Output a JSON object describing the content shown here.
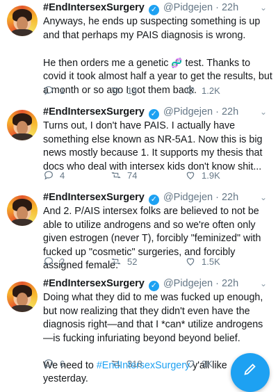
{
  "tweets": [
    {
      "name": "#EndIntersexSurgery",
      "handle": "@Pidgejen",
      "time": "22h",
      "p1": "Anyways, he ends up suspecting something is up and that perhaps my PAIS diagnosis is wrong.",
      "p2a": "He then orders me a genetic ",
      "dna": "🧬",
      "p2b": " test. Thanks to covid it took almost half a year to get the results, but a month or so ago I got them back.",
      "replies": "1",
      "retweets": "14",
      "likes": "1.2K"
    },
    {
      "name": "#EndIntersexSurgery",
      "handle": "@Pidgejen",
      "time": "22h",
      "p1": "Turns out, I don't have PAIS. I actually have something else known as NR-5A1. Now this is big news mostly because 1. It supports my thesis that docs who deal with intersex kids don't know shit...",
      "replies": "4",
      "retweets": "74",
      "likes": "1.9K"
    },
    {
      "name": "#EndIntersexSurgery",
      "handle": "@Pidgejen",
      "time": "22h",
      "p1": "And 2. P/AIS intersex folks are believed to not be able to utilize androgens and so we're often only given estrogen (never T), forcibly \"feminized\" with fucked up \"cosmetic\" surgeries, and forcibly assigned female.",
      "replies": "2",
      "retweets": "52",
      "likes": "1.5K"
    },
    {
      "name": "#EndIntersexSurgery",
      "handle": "@Pidgejen",
      "time": "22h",
      "p1": "Doing what they did to me was fucked up enough, but now realizing that they didn't even have the diagnosis right—and that I *can* utilize androgens—is fucking infuriating beyond beyond belief.",
      "p2a": "We need to ",
      "hashtag": "#EndIntersexSurgery",
      "p2b": " y'all like yesterday.",
      "replies": "6",
      "retweets": "318",
      "likes": "3K"
    }
  ],
  "colors": {
    "accent": "#1da1f2",
    "muted": "#657786"
  },
  "icons": [
    "reply-icon",
    "retweet-icon",
    "like-icon",
    "share-icon",
    "verified-icon",
    "chevron-down-icon",
    "compose-icon"
  ]
}
